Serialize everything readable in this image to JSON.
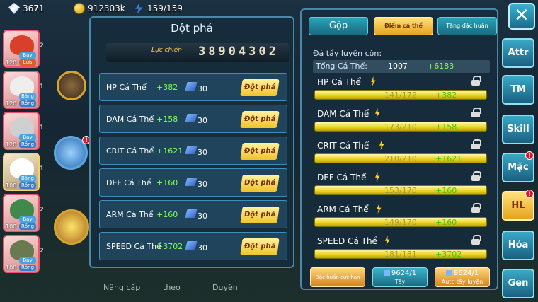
{
  "resources": {
    "gems": "3671",
    "coins": "912303k",
    "energy": "159/159"
  },
  "left_list": [
    {
      "level": "120",
      "tag1": "Bay",
      "tag2": "Lửa",
      "count": "2"
    },
    {
      "level": "120",
      "tag1": "Băng",
      "tag2": "Rồng",
      "count": "1"
    },
    {
      "level": "120",
      "tag1": "Bay",
      "tag2": "Rồng",
      "count": "1"
    },
    {
      "level": "100",
      "tag1": "Băng",
      "tag2": "Rồng",
      "count": "1"
    },
    {
      "level": "100",
      "tag1": "Bay",
      "tag2": "Rồng",
      "count": "2"
    },
    {
      "level": "100",
      "tag1": "Bay",
      "tag2": "Rồng",
      "count": "2"
    }
  ],
  "breakthrough": {
    "title": "Đột phá",
    "power_label": "Lực chiến",
    "power_value": "38904302",
    "rows": [
      {
        "name": "HP Cá Thể",
        "bonus": "+382",
        "cost": "30",
        "button": "Đột phá"
      },
      {
        "name": "DAM Cá Thể",
        "bonus": "+158",
        "cost": "30",
        "button": "Đột phá"
      },
      {
        "name": "CRIT Cá Thể",
        "bonus": "+1621",
        "cost": "30",
        "button": "Đột phá"
      },
      {
        "name": "DEF Cá Thể",
        "bonus": "+160",
        "cost": "30",
        "button": "Đột phá"
      },
      {
        "name": "ARM Cá Thể",
        "bonus": "+160",
        "cost": "30",
        "button": "Đột phá"
      },
      {
        "name": "SPEED Cá Thể",
        "bonus": "+3702",
        "cost": "30",
        "button": "Đột phá"
      }
    ]
  },
  "right_panel": {
    "tabs": {
      "gop": "Gộp",
      "diem": "Điểm cá thể",
      "tang": "Tăng đặc huấn"
    },
    "remaining_label": "Đá tẩy luyện còn:",
    "total_label": "Tổng Cá Thể:",
    "total_value": "1007",
    "total_bonus": "+6183",
    "stats": [
      {
        "name": "HP Cá Thể",
        "value": "141/172",
        "bonus": "+382"
      },
      {
        "name": "DAM Cá Thể",
        "value": "173/210",
        "bonus": "+158"
      },
      {
        "name": "CRIT Cá Thể",
        "value": "210/210",
        "bonus": "+1621"
      },
      {
        "name": "DEF Cá Thể",
        "value": "153/170",
        "bonus": "+160"
      },
      {
        "name": "ARM Cá Thể",
        "value": "149/170",
        "bonus": "+160"
      },
      {
        "name": "SPEED Cá Thể",
        "value": "181/181",
        "bonus": "+3702"
      }
    ],
    "buttons": {
      "dac_huan": "Đặc huấn cực hạn",
      "tay_cost": "9624/1",
      "tay_label": "Tẩy",
      "auto_cost": "9624/1",
      "auto_label": "Auto tẩy luyện"
    }
  },
  "side_tabs": [
    "Attr",
    "TM",
    "Skill",
    "Mặc",
    "HL",
    "Hóa",
    "Gen"
  ],
  "bottom": {
    "nang_cap": "Nâng cấp",
    "theo": "theo",
    "duyen": "Duyên"
  }
}
